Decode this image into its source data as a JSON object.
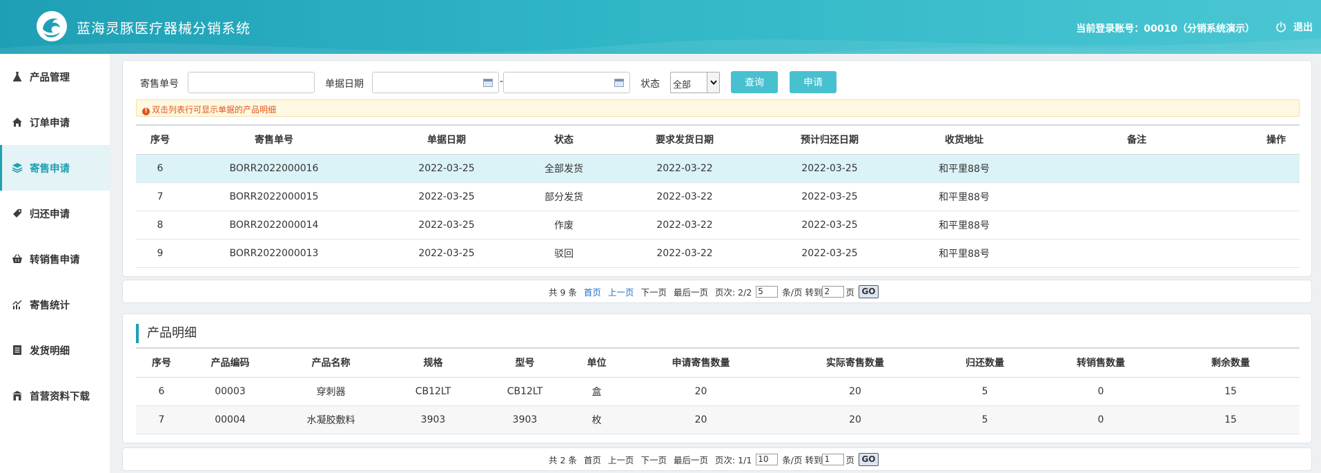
{
  "header": {
    "title": "蓝海灵豚医疗器械分销系统",
    "account": "当前登录账号：00010（分销系统演示）",
    "logout": "退出"
  },
  "sidebar": {
    "items": [
      {
        "label": "产品管理",
        "icon": "flask-icon"
      },
      {
        "label": "订单申请",
        "icon": "home-icon"
      },
      {
        "label": "寄售申请",
        "icon": "layers-icon",
        "active": true
      },
      {
        "label": "归还申请",
        "icon": "tag-icon"
      },
      {
        "label": "转销售申请",
        "icon": "basket-icon"
      },
      {
        "label": "寄售统计",
        "icon": "chart-icon"
      },
      {
        "label": "发货明细",
        "icon": "list-icon"
      },
      {
        "label": "首营资料下载",
        "icon": "download-icon"
      }
    ]
  },
  "filters": {
    "order_no_label": "寄售单号",
    "order_no_value": "",
    "date_label": "单据日期",
    "date_from": "",
    "date_separator": "-",
    "date_to": "",
    "status_label": "状态",
    "status_value": "全部",
    "query_button": "查询",
    "apply_button": "申请"
  },
  "tip": "双击列表行可显示单据的产品明细",
  "orders": {
    "headers": [
      "序号",
      "寄售单号",
      "单据日期",
      "状态",
      "要求发货日期",
      "预计归还日期",
      "收货地址",
      "备注",
      "操作"
    ],
    "rows": [
      [
        "6",
        "BORR2022000016",
        "2022-03-25",
        "全部发货",
        "2022-03-22",
        "2022-03-25",
        "和平里88号",
        "",
        ""
      ],
      [
        "7",
        "BORR2022000015",
        "2022-03-25",
        "部分发货",
        "2022-03-22",
        "2022-03-25",
        "和平里88号",
        "",
        ""
      ],
      [
        "8",
        "BORR2022000014",
        "2022-03-25",
        "作废",
        "2022-03-22",
        "2022-03-25",
        "和平里88号",
        "",
        ""
      ],
      [
        "9",
        "BORR2022000013",
        "2022-03-25",
        "驳回",
        "2022-03-22",
        "2022-03-25",
        "和平里88号",
        "",
        ""
      ]
    ]
  },
  "pager1": {
    "total": "共 9 条",
    "first": "首页",
    "prev": "上一页",
    "next": "下一页",
    "last": "最后一页",
    "page_label": "页次: 2/2",
    "page_size": "5",
    "per_page": "条/页 转到",
    "goto": "2",
    "page_unit": "页",
    "go": "GO"
  },
  "details": {
    "title": "产品明细",
    "headers": [
      "序号",
      "产品编码",
      "产品名称",
      "规格",
      "型号",
      "单位",
      "申请寄售数量",
      "实际寄售数量",
      "归还数量",
      "转销售数量",
      "剩余数量"
    ],
    "rows": [
      [
        "6",
        "00003",
        "穿刺器",
        "CB12LT",
        "CB12LT",
        "盒",
        "20",
        "20",
        "5",
        "0",
        "15"
      ],
      [
        "7",
        "00004",
        "水凝胶敷料",
        "3903",
        "3903",
        "枚",
        "20",
        "20",
        "5",
        "0",
        "15"
      ]
    ]
  },
  "pager2": {
    "total": "共 2 条",
    "first": "首页",
    "prev": "上一页",
    "next": "下一页",
    "last": "最后一页",
    "page_label": "页次: 1/1",
    "page_size": "10",
    "per_page": "条/页 转到",
    "goto": "1",
    "page_unit": "页",
    "go": "GO"
  },
  "colors": {
    "accent": "#1fa0b3",
    "button": "#47c0d0",
    "selected_row": "#dbf3f6"
  }
}
